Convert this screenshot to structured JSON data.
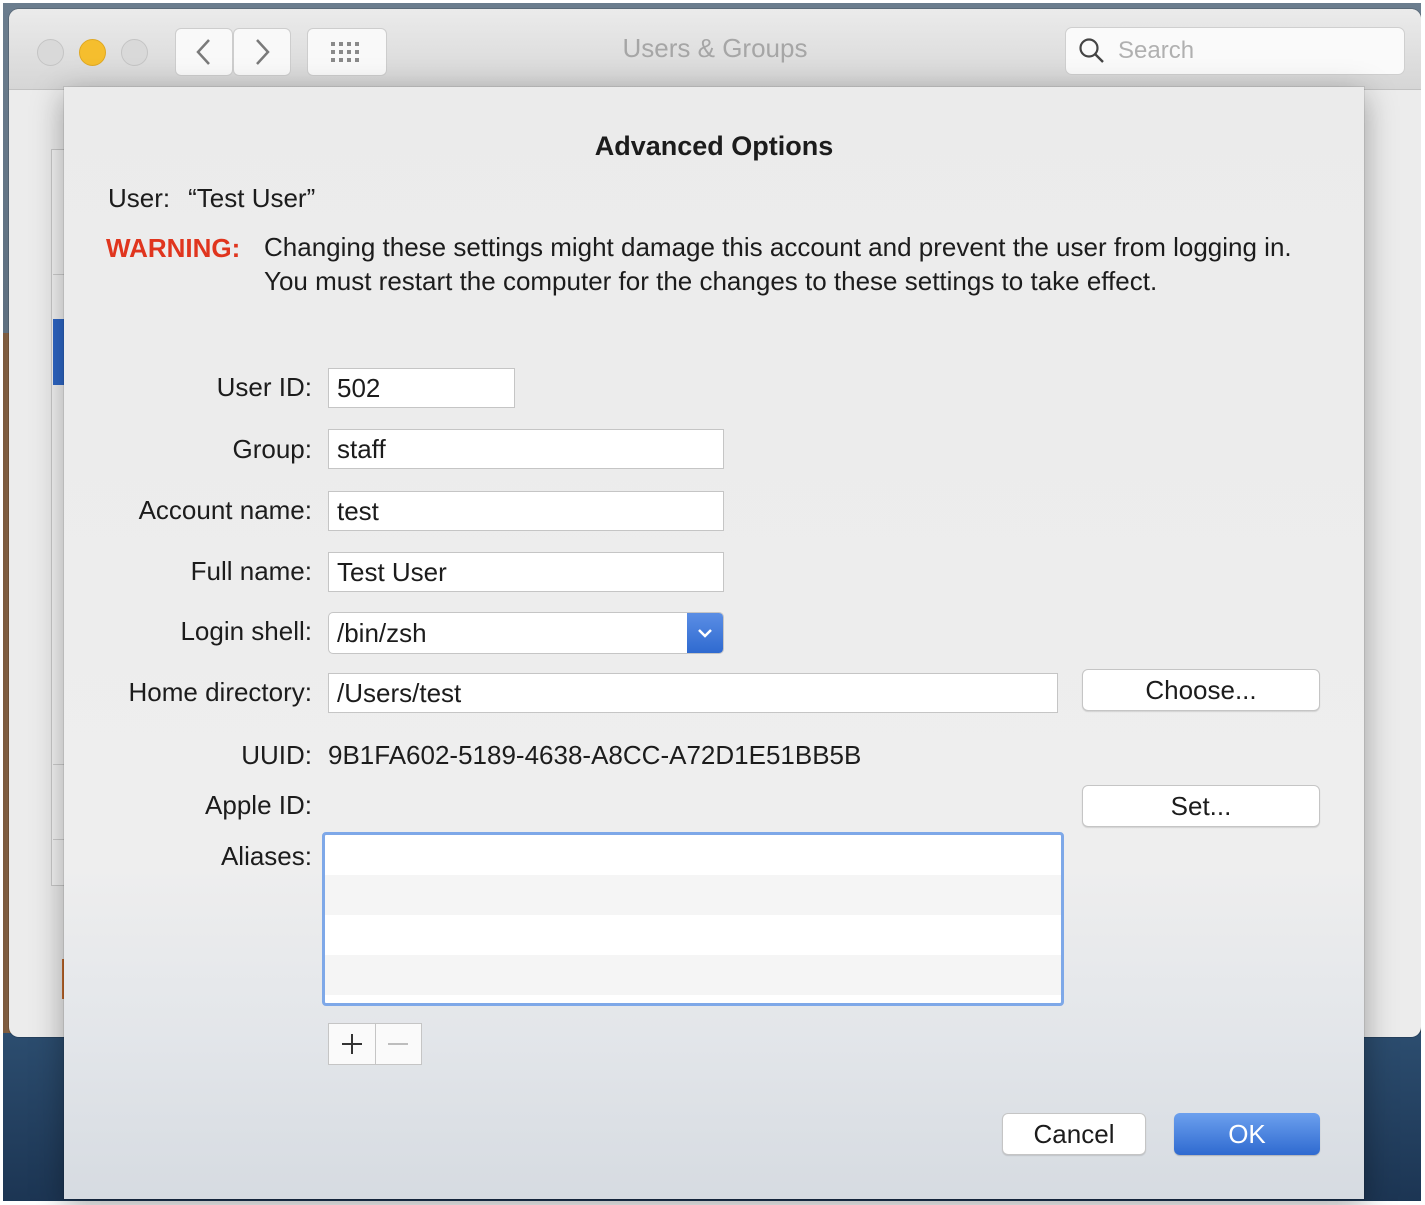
{
  "window": {
    "title": "Users & Groups",
    "search_placeholder": "Search"
  },
  "sheet": {
    "title": "Advanced Options",
    "user_label": "User:",
    "user_value": "“Test User”",
    "warning_label": "WARNING:",
    "warning_text": "Changing these settings might damage this account and prevent the user from logging in. You must restart the computer for the changes to these settings to take effect."
  },
  "form": {
    "user_id_label": "User ID:",
    "user_id": "502",
    "group_label": "Group:",
    "group": "staff",
    "account_name_label": "Account name:",
    "account_name": "test",
    "full_name_label": "Full name:",
    "full_name": "Test User",
    "login_shell_label": "Login shell:",
    "login_shell": "/bin/zsh",
    "home_directory_label": "Home directory:",
    "home_directory": "/Users/test",
    "choose_button": "Choose...",
    "uuid_label": "UUID:",
    "uuid": "9B1FA602-5189-4638-A8CC-A72D1E51BB5B",
    "apple_id_label": "Apple ID:",
    "set_button": "Set...",
    "aliases_label": "Aliases:",
    "aliases": []
  },
  "buttons": {
    "cancel": "Cancel",
    "ok": "OK"
  },
  "colors": {
    "warning": "#e0351e",
    "accent": "#2f6ad0",
    "minimize_light": "#f5be2e"
  },
  "icons": {
    "back": "chevron-left-icon",
    "forward": "chevron-right-icon",
    "show_all": "grid-icon",
    "search": "search-icon",
    "popup": "chevron-down-icon",
    "add": "plus-icon",
    "remove": "minus-icon"
  }
}
